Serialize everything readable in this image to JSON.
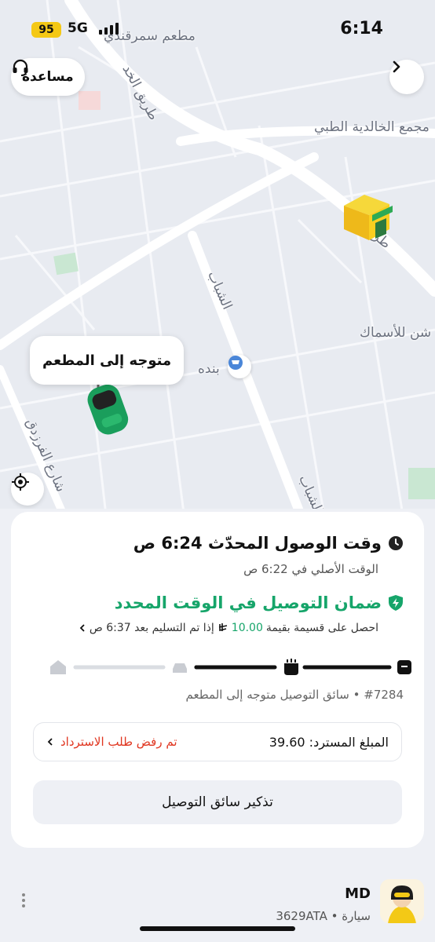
{
  "status_bar": {
    "battery": "95",
    "network": "5G",
    "time": "6:14"
  },
  "map": {
    "labels": {
      "restaurant": "مطعم سمرقندي",
      "road_north": "طريق الخد",
      "complex": "مجمع الخالدية الطبي",
      "road_east": "طريق",
      "fish": "شن للأسماك",
      "shabab_1": "الشباب",
      "shabab_2": "الشباب",
      "panda": "بنده",
      "farazdaq": "شارع الفرزدق"
    },
    "help_label": "مساعدة",
    "driver_status_bubble": "متوجه إلى المطعم"
  },
  "order_card": {
    "eta_title": "وقت الوصول المحدّث 6:24 ص",
    "eta_original": "الوقت الأصلي في 6:22 ص",
    "guarantee_title": "ضمان التوصيل في الوقت المحدد",
    "guarantee_prefix": "احصل على قسيمة بقيمة",
    "guarantee_amount": "10.00",
    "guarantee_suffix": "إذا تم التسليم بعد 6:37 ص",
    "order_info": "#7284 • سائق التوصيل متوجه إلى المطعم",
    "refund_amount": "المبلغ المسترد: 39.60",
    "refund_status": "تم رفض طلب الاسترداد",
    "remind_button": "تذكير سائق التوصيل",
    "progress_step": 2
  },
  "driver": {
    "name": "MD",
    "vehicle": "سيارة • 3629ATA"
  },
  "colors": {
    "green": "#16a56a",
    "red": "#e0351f",
    "accent_yellow": "#f4c815"
  }
}
